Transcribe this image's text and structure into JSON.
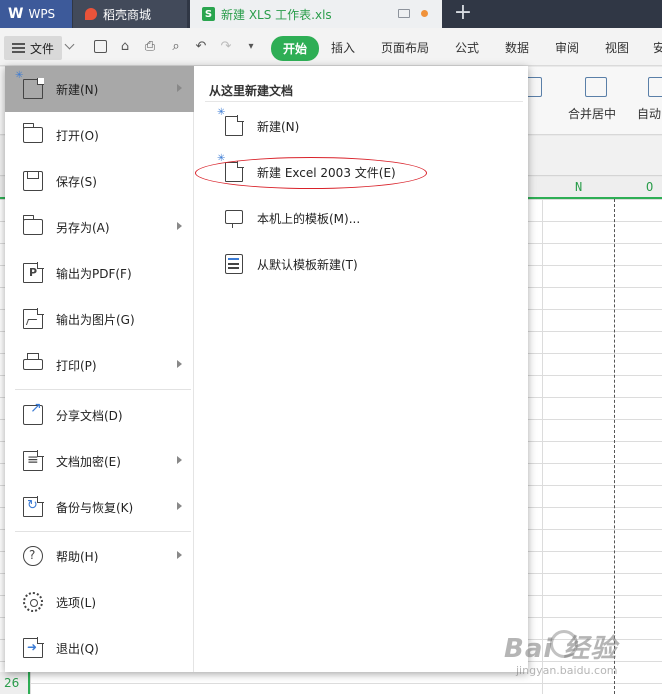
{
  "tabs": {
    "wps": "WPS",
    "shop": "稻壳商城",
    "doc": "新建 XLS 工作表.xls",
    "plus": "+"
  },
  "menubar": {
    "file_label": "文件",
    "tabs": [
      "开始",
      "插入",
      "页面布局",
      "公式",
      "数据",
      "审阅",
      "视图",
      "安"
    ]
  },
  "ribbon": {
    "merge_center": "合并居中",
    "auto_wrap": "自动"
  },
  "sheet": {
    "col_n": "N",
    "col_o": "O",
    "row_26": "26"
  },
  "file_menu": {
    "items": [
      {
        "label": "新建(N)",
        "icon": "new-doc-icon",
        "submenu": true
      },
      {
        "label": "打开(O)",
        "icon": "folder-icon",
        "submenu": false
      },
      {
        "label": "保存(S)",
        "icon": "save-icon",
        "submenu": false
      },
      {
        "label": "另存为(A)",
        "icon": "save-as-icon",
        "submenu": true
      },
      {
        "label": "输出为PDF(F)",
        "icon": "pdf-icon",
        "submenu": false
      },
      {
        "label": "输出为图片(G)",
        "icon": "image-icon",
        "submenu": false
      },
      {
        "label": "打印(P)",
        "icon": "print-icon",
        "submenu": true
      },
      {
        "label": "分享文档(D)",
        "icon": "share-icon",
        "submenu": false
      },
      {
        "label": "文档加密(E)",
        "icon": "encrypt-icon",
        "submenu": true
      },
      {
        "label": "备份与恢复(K)",
        "icon": "backup-icon",
        "submenu": true
      },
      {
        "label": "帮助(H)",
        "icon": "help-icon",
        "submenu": true
      },
      {
        "label": "选项(L)",
        "icon": "gear-icon",
        "submenu": false
      },
      {
        "label": "退出(Q)",
        "icon": "exit-icon",
        "submenu": false
      }
    ]
  },
  "new_panel": {
    "title": "从这里新建文档",
    "items": [
      {
        "label": "新建(N)",
        "icon": "new-doc-icon"
      },
      {
        "label": "新建 Excel 2003 文件(E)",
        "icon": "new-doc-icon"
      },
      {
        "label": "本机上的模板(M)...",
        "icon": "monitor-template-icon"
      },
      {
        "label": "从默认模板新建(T)",
        "icon": "template-icon"
      }
    ]
  },
  "watermark": {
    "main": "Bai 经验",
    "sub": "jingyan.baidu.com"
  },
  "colors": {
    "accent_green": "#2eae55",
    "highlight_oval": "#d9222a",
    "active_item": "#a8a8a8"
  }
}
